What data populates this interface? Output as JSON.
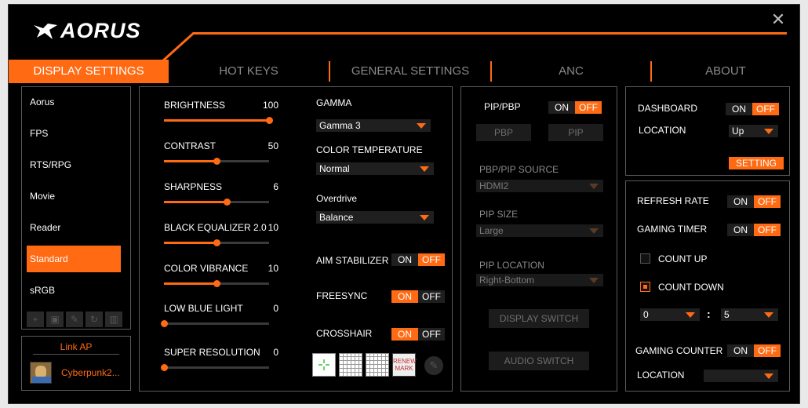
{
  "app": {
    "logo": "AORUS",
    "close_glyph": "✕"
  },
  "colors": {
    "accent": "#ff6a13",
    "background": "#000000"
  },
  "tabs": [
    {
      "label": "DISPLAY SETTINGS",
      "active": true
    },
    {
      "label": "HOT KEYS"
    },
    {
      "label": "GENERAL SETTINGS"
    },
    {
      "label": "ANC"
    },
    {
      "label": "ABOUT"
    }
  ],
  "profiles": [
    {
      "label": "Aorus"
    },
    {
      "label": "FPS"
    },
    {
      "label": "RTS/RPG"
    },
    {
      "label": "Movie"
    },
    {
      "label": "Reader"
    },
    {
      "label": "Standard",
      "selected": true
    },
    {
      "label": "sRGB"
    }
  ],
  "profile_tools": [
    "add-icon",
    "save-icon",
    "edit-icon",
    "reset-icon",
    "delete-icon"
  ],
  "link_ap": {
    "title": "Link AP",
    "app_name": "Cyberpunk2..."
  },
  "sliders": [
    {
      "label": "BRIGHTNESS",
      "value": "100",
      "level": 1.0
    },
    {
      "label": "CONTRAST",
      "value": "50",
      "level": 0.5
    },
    {
      "label": "SHARPNESS",
      "value": "6",
      "level": 0.6
    },
    {
      "label": "BLACK EQUALIZER 2.0",
      "value": "10",
      "level": 0.5
    },
    {
      "label": "COLOR VIBRANCE",
      "value": "10",
      "level": 0.5
    },
    {
      "label": "LOW BLUE LIGHT",
      "value": "0",
      "level": 0.0
    },
    {
      "label": "SUPER RESOLUTION",
      "value": "0",
      "level": 0.0
    }
  ],
  "gamma": {
    "label": "GAMMA",
    "value": "Gamma 3"
  },
  "color_temperature": {
    "label": "COLOR TEMPERATURE",
    "value": "Normal"
  },
  "overdrive": {
    "label": "Overdrive",
    "value": "Balance"
  },
  "aim_stabilizer": {
    "label": "AIM STABILIZER",
    "on": "ON",
    "off": "OFF",
    "state": "off"
  },
  "freesync": {
    "label": "FREESYNC",
    "on": "ON",
    "off": "OFF",
    "state": "on"
  },
  "crosshair": {
    "label": "CROSSHAIR",
    "on": "ON",
    "off": "OFF",
    "state": "on",
    "thumb_text": "RENEW MARK"
  },
  "pip": {
    "label": "PIP/PBP",
    "on": "ON",
    "off": "OFF",
    "state": "off",
    "pbp_button": "PBP",
    "pip_button": "PIP",
    "source_label": "PBP/PIP SOURCE",
    "source_value": "HDMI2",
    "size_label": "PIP SIZE",
    "size_value": "Large",
    "location_label": "PIP LOCATION",
    "location_value": "Right-Bottom",
    "display_switch": "DISPLAY SWITCH",
    "audio_switch": "AUDIO SWITCH"
  },
  "dashboard": {
    "label": "DASHBOARD",
    "on": "ON",
    "off": "OFF",
    "state": "off",
    "location_label": "LOCATION",
    "location_value": "Up",
    "setting_button": "SETTING"
  },
  "refresh_rate": {
    "label": "REFRESH RATE",
    "on": "ON",
    "off": "OFF",
    "state": "off"
  },
  "gaming_timer": {
    "label": "GAMING TIMER",
    "on": "ON",
    "off": "OFF",
    "state": "off",
    "count_up": "COUNT UP",
    "count_down": "COUNT DOWN",
    "mode": "count_down",
    "minutes": "0",
    "separator": ":",
    "seconds": "5"
  },
  "gaming_counter": {
    "label": "GAMING COUNTER",
    "on": "ON",
    "off": "OFF",
    "state": "off",
    "location_label": "LOCATION",
    "location_value": ""
  }
}
